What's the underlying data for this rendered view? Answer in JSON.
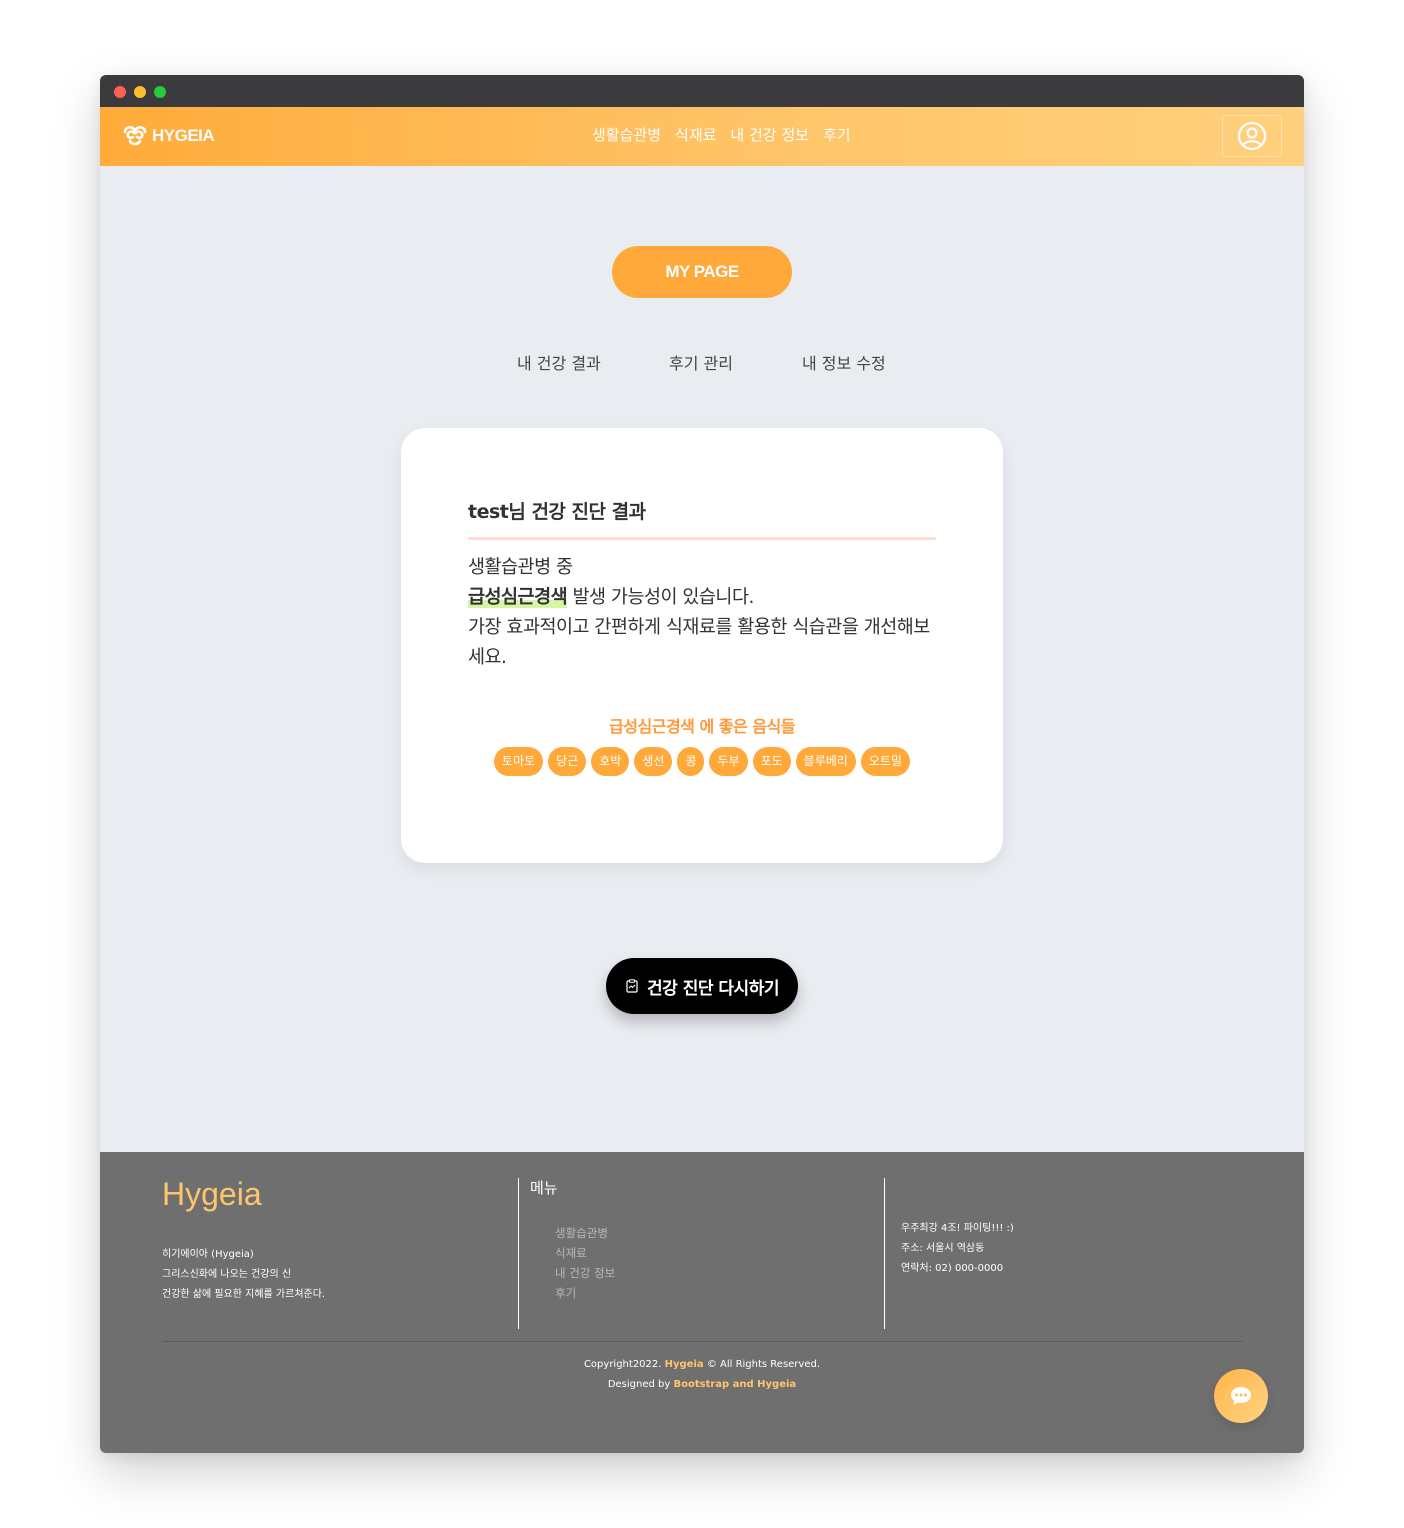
{
  "brand": {
    "name": "HYGEIA"
  },
  "nav": {
    "links": [
      "생활습관병",
      "식재료",
      "내 건강 정보",
      "후기"
    ]
  },
  "mypage": {
    "label": "MY PAGE"
  },
  "subnav": {
    "items": [
      "내 건강 결과",
      "후기 관리",
      "내 정보 수정"
    ]
  },
  "result": {
    "title": "test님 건강 진단 결과",
    "line1": "생활습관병 중",
    "disease": "급성심근경색",
    "line2_rest": " 발생 가능성이 있습니다.",
    "line3": "가장 효과적이고 간편하게 식재료를 활용한 식습관을 개선해보세요.",
    "foods_title": "급성심근경색 에 좋은 음식들",
    "foods": [
      "토마토",
      "당근",
      "호박",
      "생선",
      "콩",
      "두부",
      "포도",
      "블루베리",
      "오트밀"
    ]
  },
  "retry": {
    "label": "건강 진단 다시하기"
  },
  "footer": {
    "logo": "Hygeia",
    "about": [
      "히기에이아 (Hygeia)",
      "그리스신화에 나오는 건강의 신",
      "건강한 삶에 필요한 지혜를 가르쳐준다."
    ],
    "menu_title": "메뉴",
    "menu": [
      "생활습관병",
      "식재료",
      "내 건강 정보",
      "후기"
    ],
    "contact": [
      "우주최강 4조! 파이팅!!! :)",
      "주소: 서울시 역삼동",
      "연락처: 02) 000-0000"
    ],
    "copy_prefix": "Copyright2022. ",
    "copy_brand": "Hygeia",
    "copy_suffix": " © All Rights Reserved.",
    "designed_prefix": "Designed by ",
    "designed_by": "Bootstrap and Hygeia"
  },
  "colors": {
    "accent": "#ffa93a",
    "nav_gradient_end": "#ffd07d",
    "background": "#e9ecf1",
    "footer": "#706f6f",
    "footer_accent": "#ffc56c"
  },
  "icons": {
    "brand": "hygeia-logo-icon",
    "profile": "user-circle-icon",
    "retry": "clipboard-icon",
    "chat": "chat-bubble-icon"
  }
}
